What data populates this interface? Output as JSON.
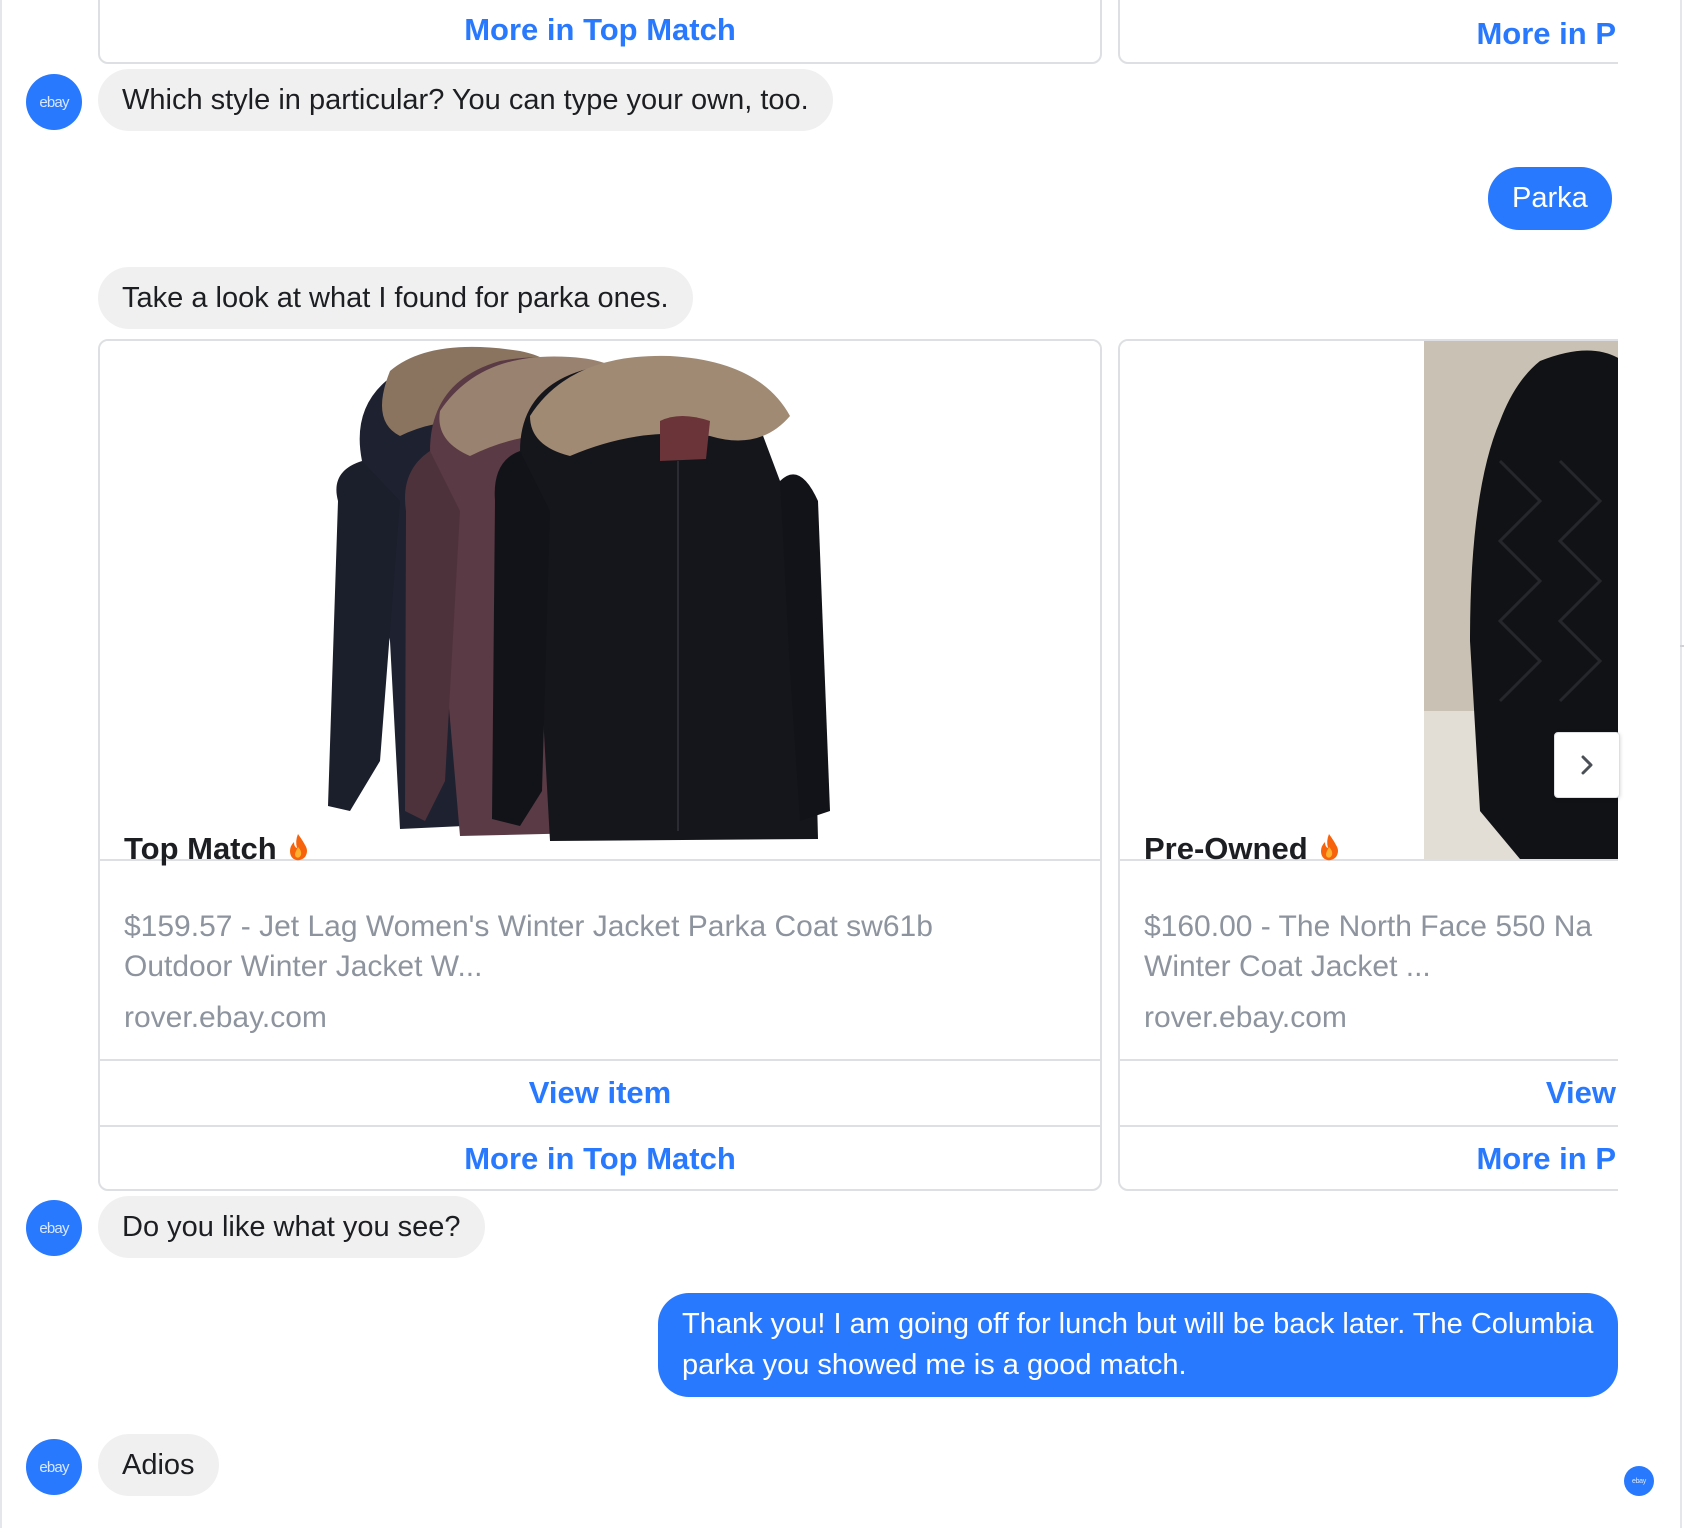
{
  "bot": {
    "avatar_label": "ebay"
  },
  "top_partial": {
    "left_button": "More in Top Match",
    "right_button": "More in P"
  },
  "messages": {
    "q_style": "Which style in particular? You can type your own, too.",
    "user_parka": "Parka",
    "found": "Take a look at what I found for parka ones.",
    "like": "Do you like what you see?",
    "user_thanks": "Thank you! I am going off for lunch but will be back later. The Columbia parka you showed me is a good match.",
    "adios": "Adios"
  },
  "cards": [
    {
      "title": "Top Match",
      "subtitle_line1": "$159.57 - Jet Lag Women's Winter Jacket Parka Coat sw61b",
      "subtitle_line2": "Outdoor Winter Jacket W...",
      "domain": "rover.ebay.com",
      "view_button": "View item",
      "more_button": "More in Top Match",
      "image_icon": "parka-coats-image"
    },
    {
      "title": "Pre-Owned",
      "subtitle_line1": "$160.00 - The North Face 550 Na",
      "subtitle_line2": "Winter Coat Jacket ...",
      "domain": "rover.ebay.com",
      "view_button": "View",
      "more_button": "More in P",
      "image_icon": "black-down-coat-image"
    }
  ],
  "icons": {
    "fire": "fire-icon",
    "next": "chevron-right-icon"
  },
  "colors": {
    "accent": "#2979ff",
    "bubble_in": "#f1f0f0",
    "muted_text": "#8d949e"
  }
}
